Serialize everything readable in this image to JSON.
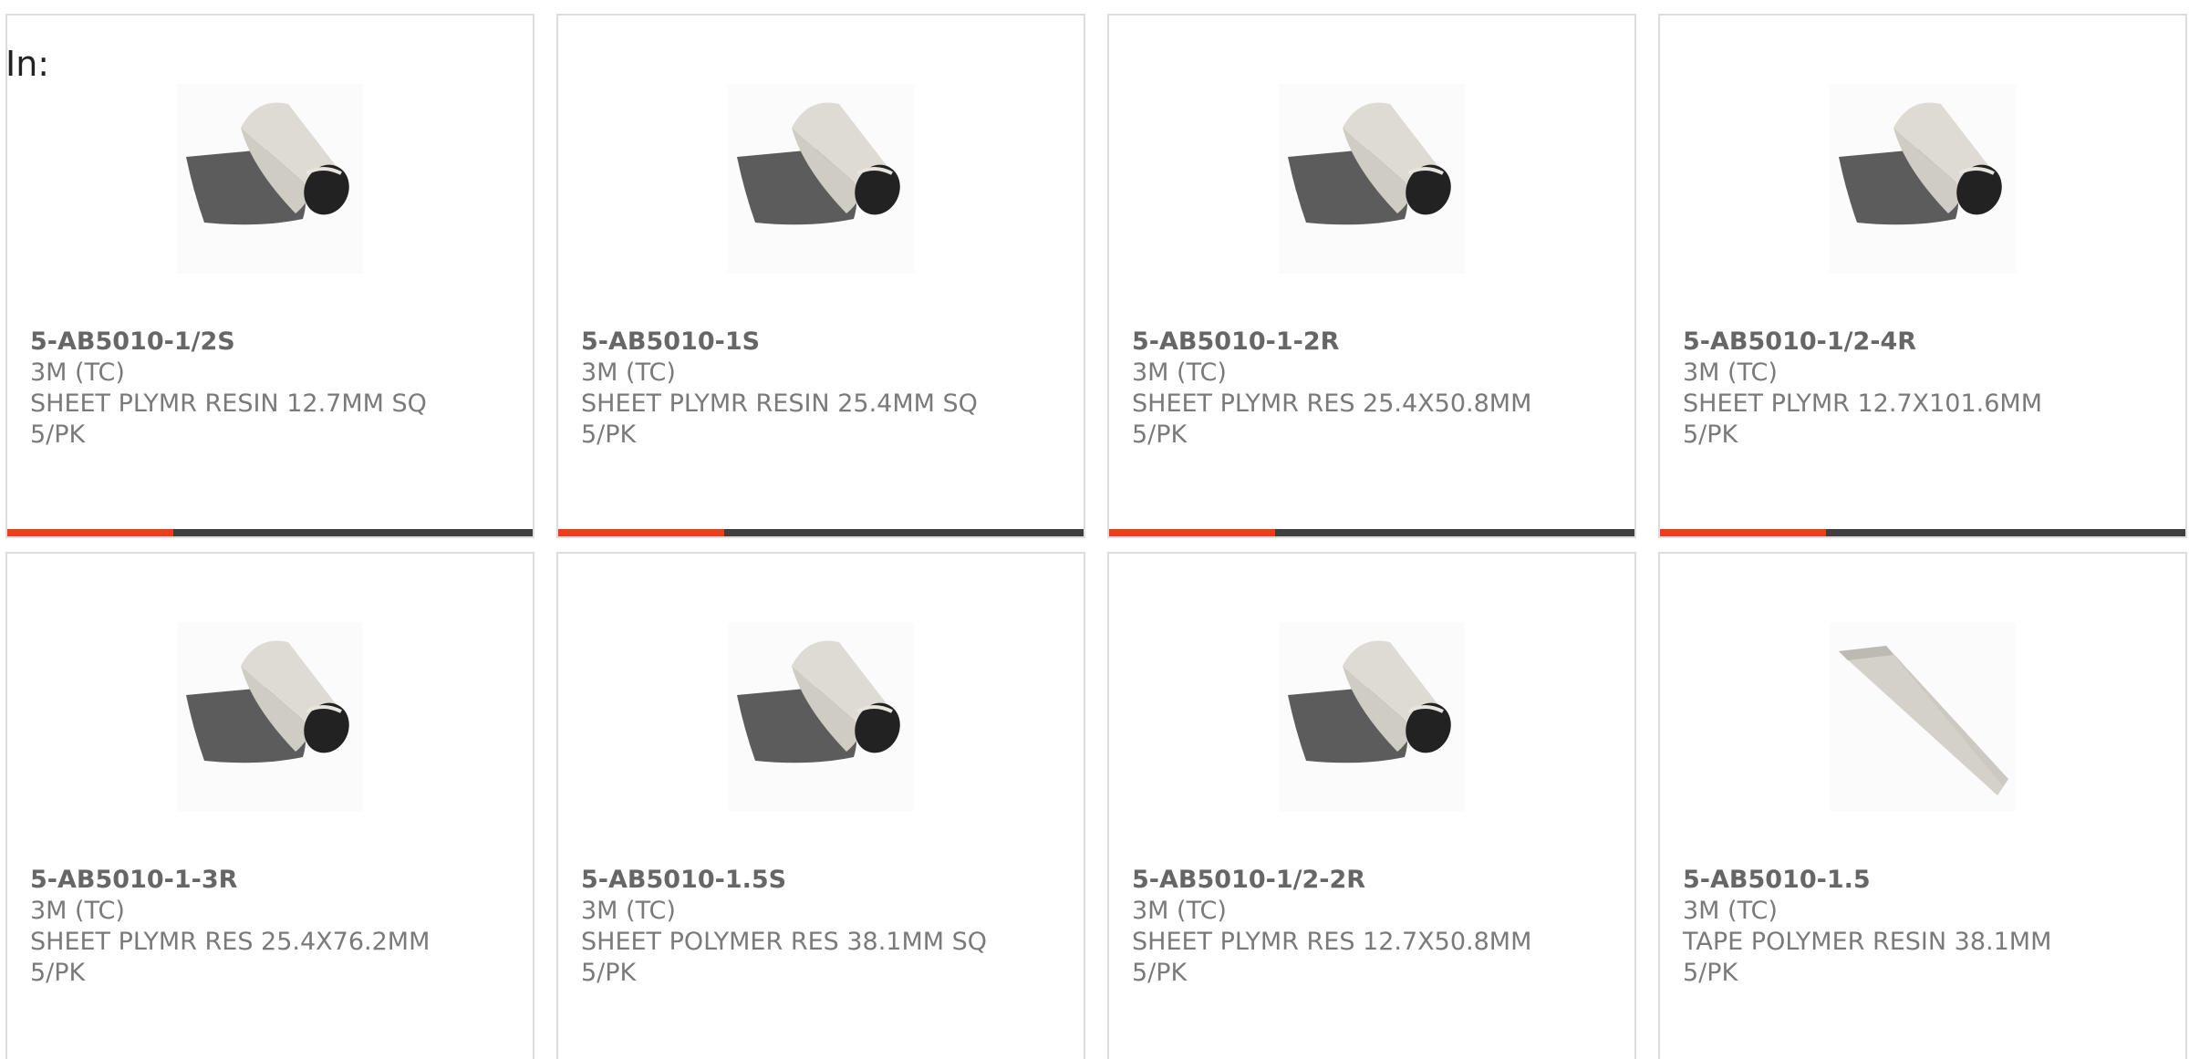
{
  "header": {
    "in_label": "In:"
  },
  "colors": {
    "accent": "#e8401c",
    "bar_dark": "#3f3f3f",
    "text_bold": "#666666",
    "text_muted": "#7a7a7a",
    "card_border": "#dddddd"
  },
  "products": [
    {
      "part_number": "5-AB5010-1/2S",
      "brand": "3M (TC)",
      "description": "SHEET PLYMR RESIN 12.7MM SQ",
      "pack": "5/PK",
      "image_icon": "rolled-sheet-image"
    },
    {
      "part_number": "5-AB5010-1S",
      "brand": "3M (TC)",
      "description": "SHEET PLYMR RESIN 25.4MM SQ",
      "pack": "5/PK",
      "image_icon": "rolled-sheet-image"
    },
    {
      "part_number": "5-AB5010-1-2R",
      "brand": "3M (TC)",
      "description": "SHEET PLYMR RES 25.4X50.8MM",
      "pack": "5/PK",
      "image_icon": "rolled-sheet-image"
    },
    {
      "part_number": "5-AB5010-1/2-4R",
      "brand": "3M (TC)",
      "description": "SHEET PLYMR 12.7X101.6MM",
      "pack": "5/PK",
      "image_icon": "rolled-sheet-image"
    },
    {
      "part_number": "5-AB5010-1-3R",
      "brand": "3M (TC)",
      "description": "SHEET PLYMR RES 25.4X76.2MM",
      "pack": "5/PK",
      "image_icon": "rolled-sheet-image"
    },
    {
      "part_number": "5-AB5010-1.5S",
      "brand": "3M (TC)",
      "description": "SHEET POLYMER RES 38.1MM SQ",
      "pack": "5/PK",
      "image_icon": "rolled-sheet-image"
    },
    {
      "part_number": "5-AB5010-1/2-2R",
      "brand": "3M (TC)",
      "description": "SHEET PLYMR RES 12.7X50.8MM",
      "pack": "5/PK",
      "image_icon": "rolled-sheet-image"
    },
    {
      "part_number": "5-AB5010-1.5",
      "brand": "3M (TC)",
      "description": "TAPE POLYMER RESIN 38.1MM",
      "pack": "5/PK",
      "image_icon": "tape-strip-image"
    }
  ]
}
